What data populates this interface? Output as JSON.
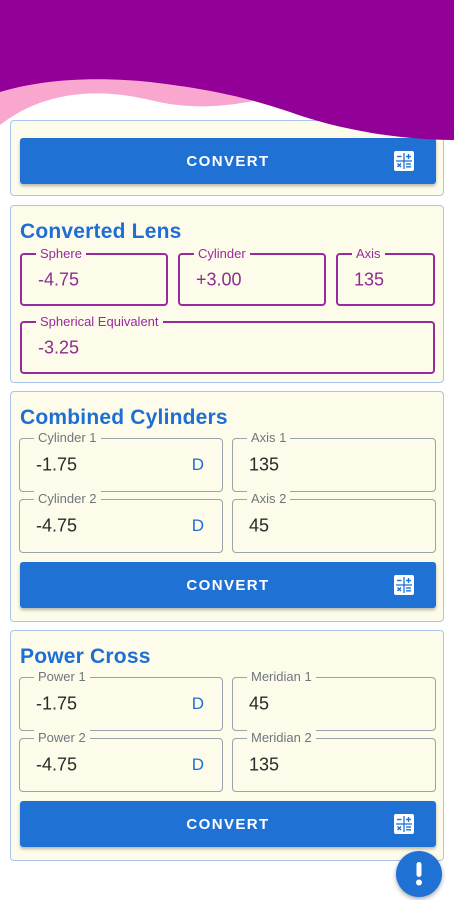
{
  "top_card": {
    "convert_label": "CONVERT"
  },
  "converted_lens": {
    "title": "Converted Lens",
    "sphere": {
      "label": "Sphere",
      "value": "-4.75"
    },
    "cylinder": {
      "label": "Cylinder",
      "value": "+3.00"
    },
    "axis": {
      "label": "Axis",
      "value": "135"
    },
    "spherical_equivalent": {
      "label": "Spherical Equivalent",
      "value": "-3.25"
    }
  },
  "combined_cylinders": {
    "title": "Combined Cylinders",
    "cylinder1": {
      "label": "Cylinder 1",
      "value": "-1.75",
      "unit": "D"
    },
    "axis1": {
      "label": "Axis 1",
      "value": "135"
    },
    "cylinder2": {
      "label": "Cylinder 2",
      "value": "-4.75",
      "unit": "D"
    },
    "axis2": {
      "label": "Axis 2",
      "value": "45"
    },
    "convert_label": "CONVERT"
  },
  "power_cross": {
    "title": "Power Cross",
    "power1": {
      "label": "Power 1",
      "value": "-1.75",
      "unit": "D"
    },
    "meridian1": {
      "label": "Meridian 1",
      "value": "45"
    },
    "power2": {
      "label": "Power 2",
      "value": "-4.75",
      "unit": "D"
    },
    "meridian2": {
      "label": "Meridian 2",
      "value": "135"
    },
    "convert_label": "CONVERT"
  },
  "fab": {
    "icon": "exclamation-icon"
  },
  "icons": {
    "convert": "calculator-icon"
  },
  "colors": {
    "header_purple": "#930097",
    "header_pink": "#f9a7cf",
    "accent_blue": "#1f72d4",
    "card_bg": "#fdfbe9",
    "field_purple": "#992a9e"
  }
}
